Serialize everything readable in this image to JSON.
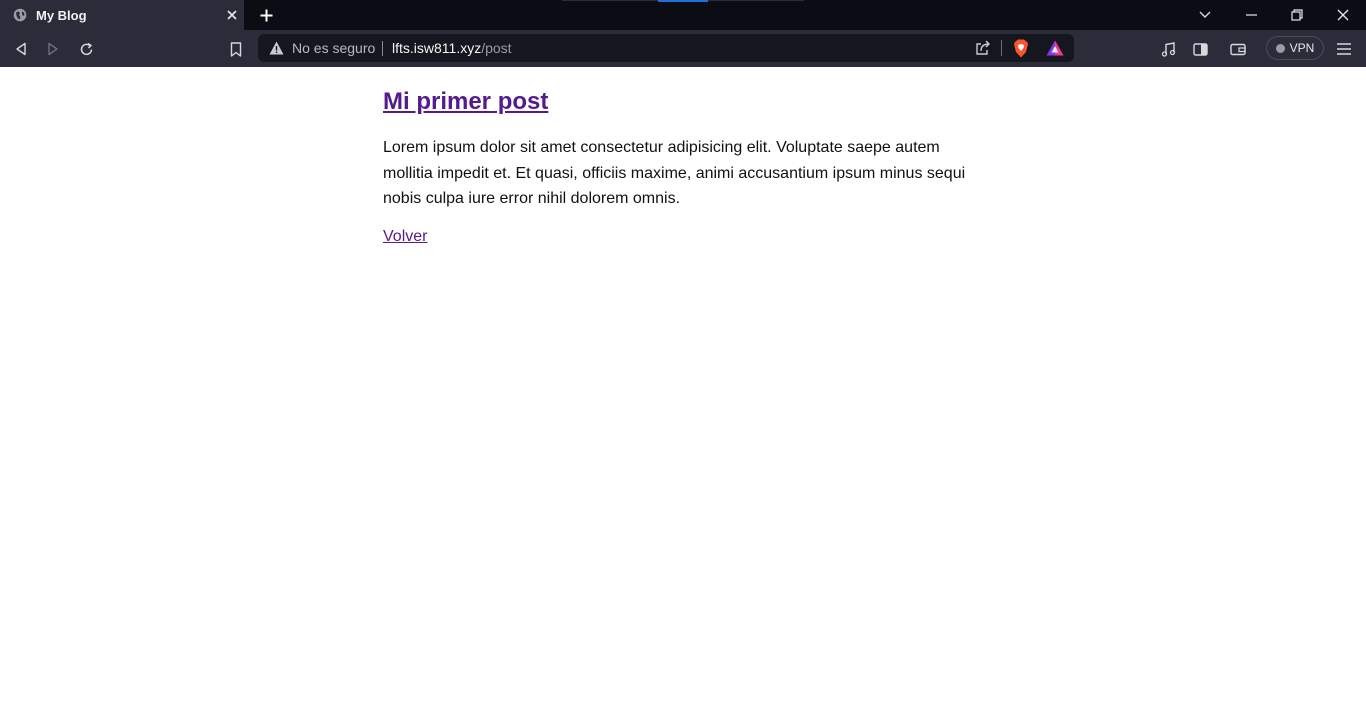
{
  "browser": {
    "tab": {
      "title": "My Blog",
      "favicon": "globe-icon"
    },
    "address_bar": {
      "security_text": "No es seguro",
      "url_host": "lfts.isw811.xyz",
      "url_path": "/post"
    },
    "vpn_label": "VPN"
  },
  "page": {
    "post_title": "Mi primer post",
    "post_body": "Lorem ipsum dolor sit amet consectetur adipisicing elit. Voluptate saepe autem mollitia impedit et. Et quasi, officiis maxime, animi accusantium ipsum minus sequi nobis culpa iure error nihil dolorem omnis.",
    "back_link": "Volver"
  },
  "colors": {
    "tabstrip_bg": "#0b0c14",
    "toolbar_bg": "#2a2c3a",
    "urlbar_bg": "#15161e",
    "link_visited": "#551a8b",
    "brave_orange": "#fb542b"
  }
}
